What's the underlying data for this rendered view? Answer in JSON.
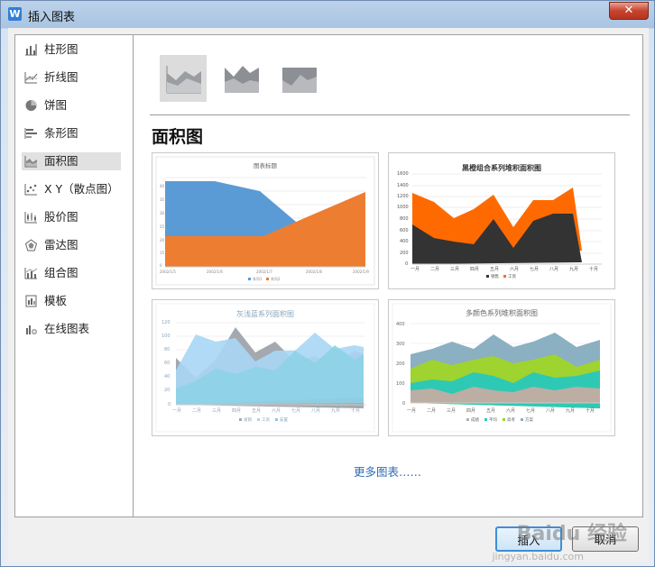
{
  "window": {
    "title": "插入图表",
    "app_icon": "W",
    "close_glyph": "✕"
  },
  "sidebar": {
    "items": [
      {
        "label": "柱形图",
        "icon": "column-chart-icon"
      },
      {
        "label": "折线图",
        "icon": "line-chart-icon"
      },
      {
        "label": "饼图",
        "icon": "pie-chart-icon"
      },
      {
        "label": "条形图",
        "icon": "bar-chart-icon"
      },
      {
        "label": "面积图",
        "icon": "area-chart-icon",
        "active": true
      },
      {
        "label": "X Y（散点图）",
        "icon": "scatter-chart-icon"
      },
      {
        "label": "股价图",
        "icon": "stock-chart-icon"
      },
      {
        "label": "雷达图",
        "icon": "radar-chart-icon"
      },
      {
        "label": "组合图",
        "icon": "combo-chart-icon"
      },
      {
        "label": "模板",
        "icon": "template-icon"
      },
      {
        "label": "在线图表",
        "icon": "online-chart-icon"
      }
    ]
  },
  "main": {
    "section_title": "面积图",
    "more_link": "更多图表……",
    "thumbnails": [
      {
        "title": "图表标题",
        "x_labels": [
          "2002/1/5",
          "2002/1/6",
          "2002/1/7",
          "2002/1/8",
          "2002/1/9"
        ],
        "y_ticks": [
          "40",
          "35",
          "30",
          "25",
          "20",
          "15",
          "10",
          "5",
          "0"
        ],
        "legend": [
          "系列1",
          "系列2"
        ],
        "colors": [
          "#5b9bd5",
          "#ed7d31"
        ]
      },
      {
        "title": "黑橙组合系列堆积面积图",
        "x_labels": [
          "一月",
          "二月",
          "三月",
          "四月",
          "五月",
          "六月",
          "七月",
          "八月",
          "九月",
          "十月"
        ],
        "y_ticks": [
          "1600",
          "1400",
          "1200",
          "1000",
          "800",
          "600",
          "400",
          "200",
          "0"
        ],
        "legend": [
          "销售",
          "工资"
        ],
        "colors": [
          "#333333",
          "#ff6a00"
        ]
      },
      {
        "title": "灰浅蓝系列面积图",
        "x_labels": [
          "一月",
          "二月",
          "三月",
          "四月",
          "五月",
          "六月",
          "七月",
          "八月",
          "九月",
          "十月"
        ],
        "y_ticks": [
          "120",
          "100",
          "80",
          "60",
          "40",
          "20",
          "0"
        ],
        "legend": [
          "发销",
          "工资",
          "安置"
        ],
        "colors": [
          "#a4a9b0",
          "#a9d6f5",
          "#8dc8e8"
        ]
      },
      {
        "title": "多颜色系列堆积面积图",
        "x_labels": [
          "一月",
          "二月",
          "三月",
          "四月",
          "五月",
          "六月",
          "七月",
          "八月",
          "九月",
          "十月"
        ],
        "y_ticks": [
          "400",
          "300",
          "200",
          "100",
          "0"
        ],
        "legend": [
          "成绩",
          "平均",
          "高考",
          "方案"
        ],
        "colors": [
          "#bcaea3",
          "#2ec9b4",
          "#9fd32f",
          "#8ab0c2"
        ]
      }
    ]
  },
  "footer": {
    "insert_label": "插入",
    "cancel_label": "取消"
  },
  "watermark": {
    "text": "Baidu 经验",
    "sub": "jingyan.baidu.com"
  }
}
